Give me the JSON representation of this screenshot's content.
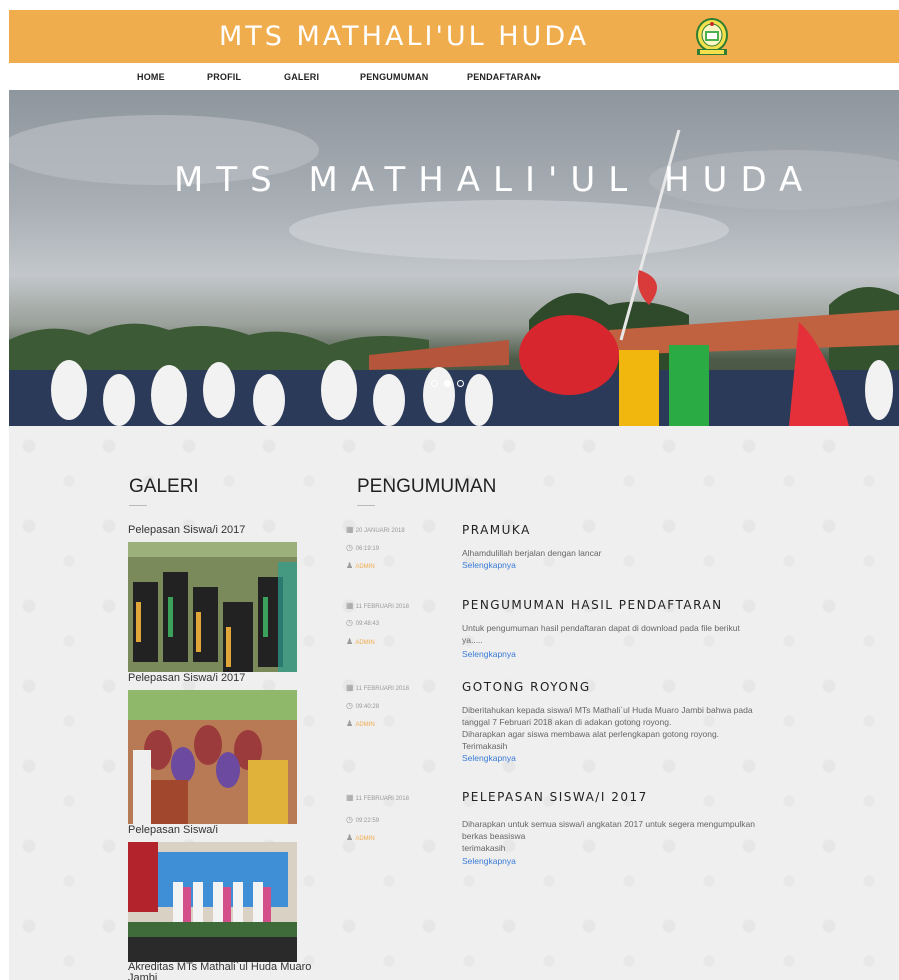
{
  "header": {
    "title": "MTS MATHALI'UL HUDA",
    "logo": "school-emblem-icon",
    "bar_color": "#f0ad4e"
  },
  "nav": {
    "items": [
      {
        "label": "HOME"
      },
      {
        "label": "PROFIL"
      },
      {
        "label": "GALERI"
      },
      {
        "label": "PENGUMUMAN"
      },
      {
        "label": "PENDAFTARAN"
      }
    ]
  },
  "hero": {
    "title": "MTS MATHALI'UL HUDA",
    "slide_count": 3,
    "active_slide": 1
  },
  "galeri": {
    "heading": "GALERI",
    "items": [
      {
        "caption": "Pelepasan Siswa/i 2017"
      },
      {
        "caption": "Pelepasan Siswa/i 2017"
      },
      {
        "caption": "Pelepasan Siswa/i"
      },
      {
        "caption": "Akreditas MTs Mathali`ul Huda Muaro Jambi"
      }
    ]
  },
  "pengumuman": {
    "heading": "PENGUMUMAN",
    "items": [
      {
        "date": "20 JANUARI 2018",
        "time": "06:19:19",
        "author": "ADMIN",
        "title": "PRAMUKA",
        "body": [
          "Alhamdulillah berjalan dengan lancar"
        ],
        "link": "Selengkapnya"
      },
      {
        "date": "11 FEBRUARI 2018",
        "time": "09:48:43",
        "author": "ADMIN",
        "title": "PENGUMUMAN HASIL PENDAFTARAN",
        "body": [
          "Untuk pengumuman hasil pendaftaran dapat di download pada file berikut",
          "ya....."
        ],
        "link": "Selengkapnya"
      },
      {
        "date": "11 FEBRUARI 2018",
        "time": "09:40:28",
        "author": "ADMIN",
        "title": "GOTONG ROYONG",
        "body": [
          "Diberitahukan kepada siswa/i MTs Mathali`ul Huda Muaro Jambi bahwa pada",
          "tanggal 7 Februari 2018 akan di adakan gotong royong.",
          "Diharapkan agar siswa membawa alat perlengkapan gotong royong.",
          "Terimakasih"
        ],
        "link": "Selengkapnya"
      },
      {
        "date": "11 FEBRUARI 2018",
        "time": "09:22:59",
        "author": "ADMIN",
        "title": "PELEPASAN SISWA/I 2017",
        "body": [
          "Diharapkan untuk semua siswa/i angkatan 2017 untuk segera mengumpulkan",
          "berkas beasiswa",
          "terimakasih"
        ],
        "link": "Selengkapnya"
      }
    ]
  }
}
